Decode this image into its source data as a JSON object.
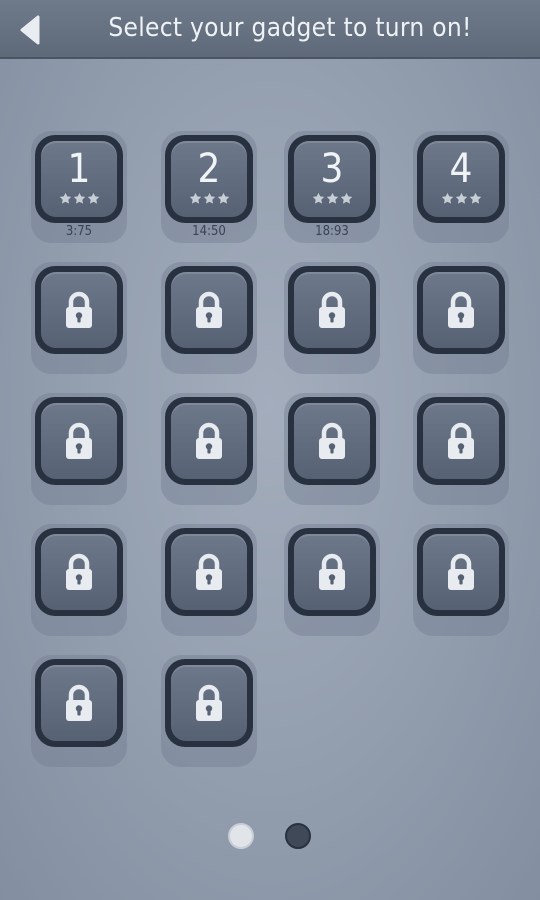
{
  "header": {
    "title": "Select your gadget to turn on!",
    "back_icon": "back-arrow-icon"
  },
  "levels": [
    {
      "label": "1",
      "time": "3:75",
      "stars": 3,
      "locked": false
    },
    {
      "label": "2",
      "time": "14:50",
      "stars": 3,
      "locked": false
    },
    {
      "label": "3",
      "time": "18:93",
      "stars": 3,
      "locked": false
    },
    {
      "label": "4",
      "time": "",
      "stars": 3,
      "locked": false
    },
    {
      "locked": true
    },
    {
      "locked": true
    },
    {
      "locked": true
    },
    {
      "locked": true
    },
    {
      "locked": true
    },
    {
      "locked": true
    },
    {
      "locked": true
    },
    {
      "locked": true
    },
    {
      "locked": true
    },
    {
      "locked": true
    },
    {
      "locked": true
    },
    {
      "locked": true
    },
    {
      "locked": true
    },
    {
      "locked": true
    }
  ],
  "pagination": {
    "pages": 2,
    "current": 1
  },
  "colors": {
    "background": "#95a0b0",
    "header": "#666f7f",
    "tile_border": "#283140",
    "tile_face": "#627085",
    "icon": "#e8ecf0",
    "star": "#c8ced6"
  }
}
